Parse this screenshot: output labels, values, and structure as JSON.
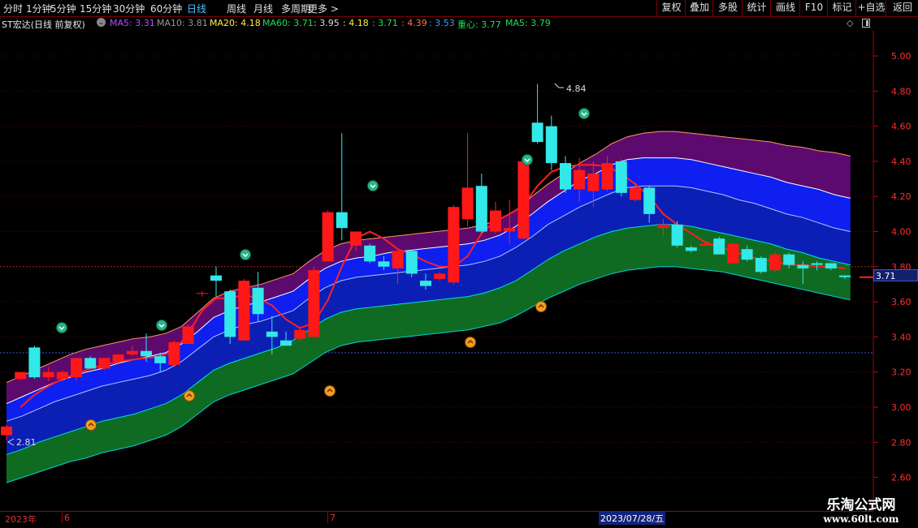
{
  "toolbar": {
    "periods": [
      "分时",
      "1分钟",
      "5分钟",
      "15分钟",
      "30分钟",
      "60分钟",
      "日线",
      "周线",
      "月线",
      "多周期",
      "更多 >"
    ],
    "active_period": "日线",
    "buttons": [
      "复权",
      "叠加",
      "多股",
      "统计",
      "画线",
      "F10",
      "标记",
      "+自选",
      "返回"
    ]
  },
  "info": {
    "stock_title": "ST宏达(日线 前复权)",
    "ma5": "MA5: 3.31",
    "ma10": "MA10: 3.81",
    "ma20": "MA20: 4.18",
    "ma60": "MA60: 3.71",
    "v1": ": 3.95",
    "v2": ": 4.18",
    "v3": ": 3.71",
    "v4": ": 4.39",
    "v5": ": 3.53",
    "center": "重心: 3.77",
    "ma5b": "MA5: 3.79",
    "colors": {
      "ma5": "#b050ff",
      "ma10": "#9a9a9a",
      "ma20": "#ffee44",
      "ma60": "#22dd55",
      "v1": "#dddddd",
      "v2": "#ffee44",
      "v3": "#22dd55",
      "v4": "#ff7744",
      "v5": "#3a9aff",
      "center": "#22dd55",
      "ma5b": "#22dd55"
    }
  },
  "axis": {
    "right_ticks": [
      "5.00",
      "4.80",
      "4.60",
      "4.40",
      "4.20",
      "4.00",
      "3.80",
      "3.60",
      "3.40",
      "3.20",
      "3.00",
      "2.80",
      "2.60"
    ],
    "bottom_labels": [
      "2023年",
      "6",
      "7"
    ],
    "date_box": "2023/07/28/五"
  },
  "annotations": {
    "high": "4.84",
    "low": "2.81"
  },
  "price_tag": "3.71",
  "watermark": {
    "line1": "乐淘公式网",
    "line2": "www.60lt.com"
  },
  "chart_data": {
    "type": "candlestick",
    "ylim": [
      2.55,
      5.07
    ],
    "title": "ST宏达(日线 前复权)",
    "candles": [
      {
        "o": 2.84,
        "h": 2.9,
        "l": 2.81,
        "c": 2.89
      },
      {
        "o": 3.16,
        "h": 3.2,
        "l": 3.15,
        "c": 3.2
      },
      {
        "o": 3.34,
        "h": 3.35,
        "l": 3.16,
        "c": 3.17
      },
      {
        "o": 3.17,
        "h": 3.23,
        "l": 3.15,
        "c": 3.2
      },
      {
        "o": 3.16,
        "h": 3.21,
        "l": 3.15,
        "c": 3.2
      },
      {
        "o": 3.17,
        "h": 3.27,
        "l": 3.15,
        "c": 3.28
      },
      {
        "o": 3.28,
        "h": 3.29,
        "l": 3.22,
        "c": 3.22
      },
      {
        "o": 3.22,
        "h": 3.28,
        "l": 3.21,
        "c": 3.28
      },
      {
        "o": 3.26,
        "h": 3.3,
        "l": 3.24,
        "c": 3.3
      },
      {
        "o": 3.3,
        "h": 3.35,
        "l": 3.29,
        "c": 3.32
      },
      {
        "o": 3.32,
        "h": 3.42,
        "l": 3.26,
        "c": 3.29
      },
      {
        "o": 3.29,
        "h": 3.31,
        "l": 3.2,
        "c": 3.25
      },
      {
        "o": 3.24,
        "h": 3.38,
        "l": 3.23,
        "c": 3.37
      },
      {
        "o": 3.36,
        "h": 3.47,
        "l": 3.36,
        "c": 3.46
      },
      {
        "o": 3.65,
        "h": 3.66,
        "l": 3.63,
        "c": 3.65
      },
      {
        "o": 3.75,
        "h": 3.8,
        "l": 3.63,
        "c": 3.72
      },
      {
        "o": 3.66,
        "h": 3.67,
        "l": 3.36,
        "c": 3.4
      },
      {
        "o": 3.38,
        "h": 3.73,
        "l": 3.38,
        "c": 3.72
      },
      {
        "o": 3.68,
        "h": 3.77,
        "l": 3.49,
        "c": 3.53
      },
      {
        "o": 3.43,
        "h": 3.52,
        "l": 3.3,
        "c": 3.4
      },
      {
        "o": 3.38,
        "h": 3.43,
        "l": 3.36,
        "c": 3.35
      },
      {
        "o": 3.39,
        "h": 3.46,
        "l": 3.38,
        "c": 3.44
      },
      {
        "o": 3.4,
        "h": 3.8,
        "l": 3.4,
        "c": 3.78
      },
      {
        "o": 3.83,
        "h": 4.12,
        "l": 3.83,
        "c": 4.11
      },
      {
        "o": 4.11,
        "h": 4.56,
        "l": 3.95,
        "c": 4.02
      },
      {
        "o": 3.92,
        "h": 4.0,
        "l": 3.89,
        "c": 4.0
      },
      {
        "o": 3.92,
        "h": 3.93,
        "l": 3.82,
        "c": 3.83
      },
      {
        "o": 3.83,
        "h": 3.86,
        "l": 3.78,
        "c": 3.8
      },
      {
        "o": 3.79,
        "h": 3.9,
        "l": 3.7,
        "c": 3.89
      },
      {
        "o": 3.89,
        "h": 3.89,
        "l": 3.74,
        "c": 3.76
      },
      {
        "o": 3.72,
        "h": 3.76,
        "l": 3.67,
        "c": 3.69
      },
      {
        "o": 3.73,
        "h": 3.77,
        "l": 3.72,
        "c": 3.76
      },
      {
        "o": 3.71,
        "h": 4.15,
        "l": 3.7,
        "c": 4.14
      },
      {
        "o": 4.07,
        "h": 4.56,
        "l": 4.03,
        "c": 4.25
      },
      {
        "o": 4.26,
        "h": 4.33,
        "l": 3.99,
        "c": 4.0
      },
      {
        "o": 4.0,
        "h": 4.17,
        "l": 3.99,
        "c": 4.12
      },
      {
        "o": 4.0,
        "h": 4.18,
        "l": 3.93,
        "c": 4.02
      },
      {
        "o": 3.96,
        "h": 4.41,
        "l": 3.96,
        "c": 4.4
      },
      {
        "o": 4.62,
        "h": 4.84,
        "l": 4.5,
        "c": 4.51
      },
      {
        "o": 4.6,
        "h": 4.66,
        "l": 4.35,
        "c": 4.39
      },
      {
        "o": 4.39,
        "h": 4.43,
        "l": 4.22,
        "c": 4.24
      },
      {
        "o": 4.24,
        "h": 4.42,
        "l": 4.17,
        "c": 4.35
      },
      {
        "o": 4.23,
        "h": 4.4,
        "l": 4.14,
        "c": 4.33
      },
      {
        "o": 4.24,
        "h": 4.43,
        "l": 4.23,
        "c": 4.39
      },
      {
        "o": 4.4,
        "h": 4.41,
        "l": 4.2,
        "c": 4.22
      },
      {
        "o": 4.18,
        "h": 4.28,
        "l": 4.17,
        "c": 4.25
      },
      {
        "o": 4.25,
        "h": 4.26,
        "l": 4.05,
        "c": 4.1
      },
      {
        "o": 4.02,
        "h": 4.07,
        "l": 3.97,
        "c": 4.04
      },
      {
        "o": 4.04,
        "h": 4.06,
        "l": 3.91,
        "c": 3.92
      },
      {
        "o": 3.91,
        "h": 3.92,
        "l": 3.88,
        "c": 3.89
      },
      {
        "o": 3.92,
        "h": 3.94,
        "l": 3.92,
        "c": 3.93
      },
      {
        "o": 3.96,
        "h": 3.97,
        "l": 3.89,
        "c": 3.87
      },
      {
        "o": 3.82,
        "h": 3.94,
        "l": 3.81,
        "c": 3.93
      },
      {
        "o": 3.9,
        "h": 3.92,
        "l": 3.83,
        "c": 3.84
      },
      {
        "o": 3.85,
        "h": 3.86,
        "l": 3.76,
        "c": 3.77
      },
      {
        "o": 3.78,
        "h": 3.88,
        "l": 3.77,
        "c": 3.87
      },
      {
        "o": 3.87,
        "h": 3.88,
        "l": 3.79,
        "c": 3.81
      },
      {
        "o": 3.81,
        "h": 3.83,
        "l": 3.7,
        "c": 3.79
      },
      {
        "o": 3.82,
        "h": 3.83,
        "l": 3.78,
        "c": 3.81
      },
      {
        "o": 3.82,
        "h": 3.82,
        "l": 3.78,
        "c": 3.79
      },
      {
        "o": 3.75,
        "h": 3.75,
        "l": 3.73,
        "c": 3.74
      }
    ],
    "bands": {
      "top": [
        3.14,
        3.18,
        3.22,
        3.26,
        3.3,
        3.33,
        3.35,
        3.37,
        3.39,
        3.4,
        3.42,
        3.46,
        3.54,
        3.62,
        3.66,
        3.68,
        3.7,
        3.73,
        3.76,
        3.83,
        3.89,
        3.93,
        3.95,
        3.96,
        3.97,
        3.98,
        3.99,
        4.0,
        4.01,
        4.02,
        4.04,
        4.07,
        4.12,
        4.2,
        4.27,
        4.33,
        4.39,
        4.44,
        4.5,
        4.54,
        4.56,
        4.57,
        4.57,
        4.56,
        4.55,
        4.54,
        4.53,
        4.52,
        4.51,
        4.49,
        4.48,
        4.46,
        4.45,
        4.43
      ],
      "upper": [
        3.02,
        3.06,
        3.1,
        3.14,
        3.17,
        3.2,
        3.22,
        3.25,
        3.27,
        3.29,
        3.31,
        3.36,
        3.43,
        3.51,
        3.55,
        3.58,
        3.6,
        3.63,
        3.66,
        3.73,
        3.79,
        3.83,
        3.85,
        3.86,
        3.88,
        3.89,
        3.9,
        3.91,
        3.92,
        3.93,
        3.95,
        3.98,
        4.03,
        4.1,
        4.17,
        4.23,
        4.29,
        4.33,
        4.38,
        4.41,
        4.42,
        4.42,
        4.42,
        4.41,
        4.39,
        4.37,
        4.35,
        4.33,
        4.31,
        4.28,
        4.26,
        4.24,
        4.21,
        4.19
      ],
      "mid": [
        2.92,
        2.95,
        2.99,
        3.03,
        3.06,
        3.09,
        3.12,
        3.14,
        3.16,
        3.18,
        3.21,
        3.26,
        3.33,
        3.4,
        3.44,
        3.47,
        3.49,
        3.52,
        3.55,
        3.62,
        3.68,
        3.72,
        3.74,
        3.75,
        3.76,
        3.77,
        3.78,
        3.79,
        3.8,
        3.81,
        3.83,
        3.86,
        3.91,
        3.97,
        4.04,
        4.09,
        4.14,
        4.18,
        4.22,
        4.25,
        4.26,
        4.26,
        4.26,
        4.25,
        4.23,
        4.21,
        4.18,
        4.16,
        4.13,
        4.1,
        4.08,
        4.05,
        4.02,
        4.0
      ],
      "lower": [
        2.73,
        2.76,
        2.8,
        2.83,
        2.86,
        2.89,
        2.92,
        2.94,
        2.96,
        2.99,
        3.02,
        3.07,
        3.14,
        3.21,
        3.25,
        3.28,
        3.31,
        3.34,
        3.38,
        3.44,
        3.5,
        3.54,
        3.56,
        3.57,
        3.58,
        3.59,
        3.6,
        3.61,
        3.62,
        3.63,
        3.65,
        3.68,
        3.72,
        3.78,
        3.84,
        3.89,
        3.93,
        3.97,
        4.0,
        4.02,
        4.03,
        4.04,
        4.04,
        4.03,
        4.01,
        3.99,
        3.97,
        3.95,
        3.93,
        3.9,
        3.88,
        3.85,
        3.83,
        3.81
      ],
      "bottom": [
        2.57,
        2.6,
        2.63,
        2.66,
        2.69,
        2.71,
        2.74,
        2.76,
        2.78,
        2.81,
        2.84,
        2.89,
        2.96,
        3.03,
        3.07,
        3.1,
        3.13,
        3.16,
        3.19,
        3.25,
        3.31,
        3.35,
        3.37,
        3.38,
        3.39,
        3.4,
        3.41,
        3.42,
        3.43,
        3.44,
        3.46,
        3.48,
        3.52,
        3.57,
        3.62,
        3.66,
        3.7,
        3.73,
        3.76,
        3.78,
        3.79,
        3.8,
        3.8,
        3.79,
        3.78,
        3.77,
        3.75,
        3.73,
        3.71,
        3.69,
        3.67,
        3.65,
        3.63,
        3.61
      ]
    },
    "ma_line": [
      null,
      3.0,
      3.07,
      3.12,
      3.16,
      3.19,
      3.22,
      3.24,
      3.26,
      3.27,
      3.28,
      3.29,
      3.32,
      3.42,
      3.55,
      3.62,
      3.62,
      3.64,
      3.62,
      3.58,
      3.5,
      3.45,
      3.48,
      3.61,
      3.8,
      3.96,
      4.0,
      3.96,
      3.9,
      3.87,
      3.83,
      3.8,
      3.8,
      3.86,
      3.99,
      4.06,
      4.1,
      4.15,
      4.26,
      4.34,
      4.37,
      4.38,
      4.38,
      4.37,
      4.33,
      4.27,
      4.2,
      4.1,
      4.04,
      3.99,
      3.94,
      3.91,
      3.89,
      3.86,
      3.84,
      3.83,
      3.81,
      3.81,
      3.8,
      3.8,
      3.79
    ],
    "markers_buy": [
      4,
      11,
      13,
      23,
      33,
      37
    ],
    "markers_sell": [
      4,
      11,
      17,
      26,
      36,
      41
    ]
  }
}
